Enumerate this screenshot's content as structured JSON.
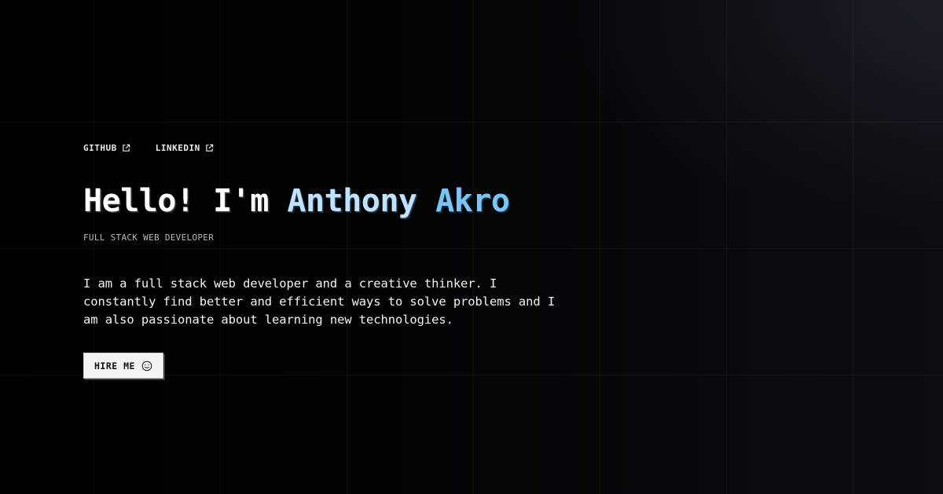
{
  "social": {
    "github_label": "GITHUB",
    "linkedin_label": "LINKEDIN",
    "link_icon": "external-link-icon"
  },
  "hero": {
    "greeting": "Hello! I'm",
    "first_name": "Anthony",
    "last_name": "Akro",
    "subtitle": "FULL STACK WEB DEVELOPER",
    "bio": "I am a full stack web developer and a creative thinker. I constantly find better and efficient ways to solve problems and I am also passionate about learning new technologies.",
    "hire_label": "HIRE ME",
    "hire_icon": "smiley-icon"
  },
  "colors": {
    "background": "#000000",
    "text_primary": "#ffffff",
    "name_first": "#bfe2ff",
    "name_last": "#7cc4f5",
    "subtitle": "#b8b8b8",
    "button_bg": "#f4f4f4"
  }
}
